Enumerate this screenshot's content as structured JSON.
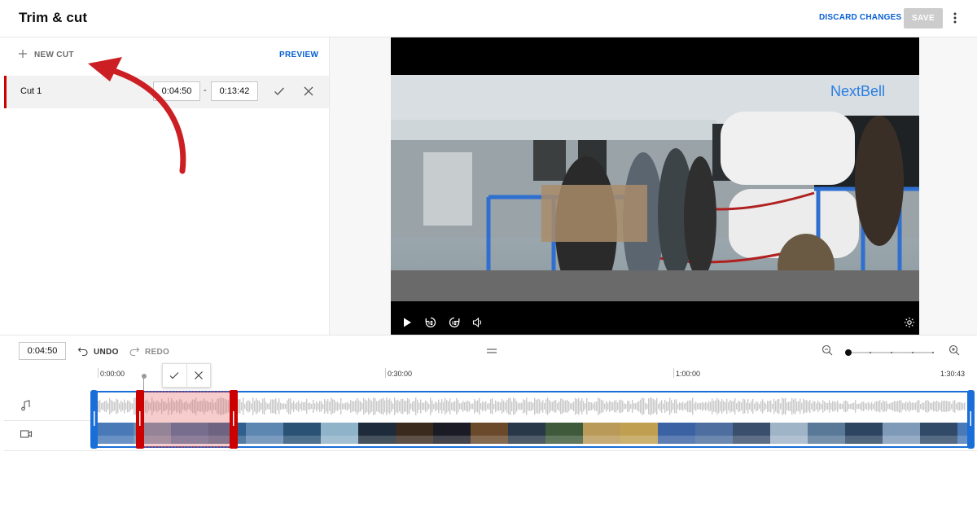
{
  "header": {
    "title": "Trim & cut",
    "discard_label": "DISCARD CHANGES",
    "save_label": "SAVE"
  },
  "left_panel": {
    "new_cut_label": "NEW CUT",
    "preview_label": "PREVIEW",
    "cut": {
      "label": "Cut 1",
      "start": "0:04:50",
      "separator": "-",
      "end": "0:13:42"
    }
  },
  "video": {
    "watermark": "NextBell"
  },
  "timeline": {
    "current_time": "0:04:50",
    "undo_label": "UNDO",
    "redo_label": "REDO",
    "ticks": [
      "0:00:00",
      "0:30:00",
      "1:00:00",
      "1:30:43"
    ]
  },
  "colors": {
    "accent_blue": "#065fd4",
    "cut_red": "#cc0000",
    "timeline_blue": "#1a6ed8",
    "save_disabled": "#cccccc"
  }
}
